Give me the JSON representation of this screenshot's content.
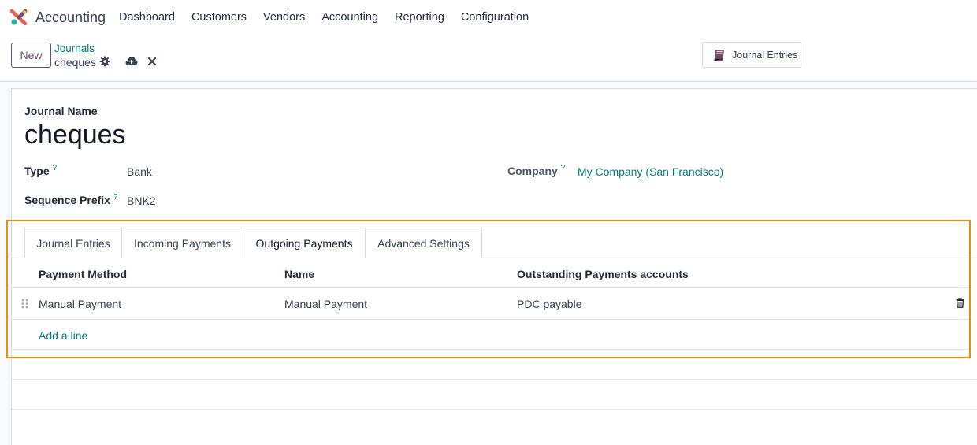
{
  "app": {
    "name": "Accounting"
  },
  "nav": {
    "items": [
      "Dashboard",
      "Customers",
      "Vendors",
      "Accounting",
      "Reporting",
      "Configuration"
    ]
  },
  "control": {
    "new_label": "New",
    "breadcrumb_parent": "Journals",
    "breadcrumb_current": "cheques",
    "journal_entries_button": "Journal Entries"
  },
  "form": {
    "journal_name_label": "Journal Name",
    "journal_name": "cheques",
    "type_label": "Type",
    "type_value": "Bank",
    "company_label": "Company",
    "company_value": "My Company (San Francisco)",
    "sequence_prefix_label": "Sequence Prefix",
    "sequence_prefix_value": "BNK2",
    "help_mark": "?"
  },
  "tabs": [
    {
      "label": "Journal Entries",
      "active": false
    },
    {
      "label": "Incoming Payments",
      "active": false
    },
    {
      "label": "Outgoing Payments",
      "active": true
    },
    {
      "label": "Advanced Settings",
      "active": false
    }
  ],
  "table": {
    "headers": [
      "Payment Method",
      "Name",
      "Outstanding Payments accounts"
    ],
    "rows": [
      {
        "payment_method": "Manual Payment",
        "name": "Manual Payment",
        "account": "PDC payable"
      }
    ],
    "add_line": "Add a line"
  },
  "colors": {
    "accent": "#017e84",
    "brand": "#714b67",
    "highlight": "#f08a0f"
  }
}
